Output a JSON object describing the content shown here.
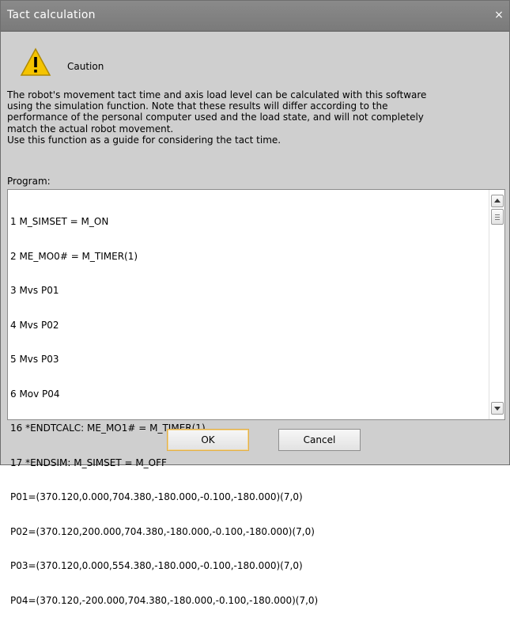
{
  "window": {
    "title": "Tact calculation",
    "close_label": "×"
  },
  "caution": {
    "icon": "warning-icon",
    "label": "Caution"
  },
  "message": {
    "lines": [
      "The robot's movement tact time and axis load level can be calculated with this software",
      "using the simulation function. Note that these results will differ according to the",
      "performance of the personal computer used and the load state, and will not completely",
      "match the actual robot movement.",
      "Use this function as a guide for considering the tact time."
    ]
  },
  "program": {
    "label": "Program:",
    "lines": [
      "1 M_SIMSET = M_ON",
      "2 ME_MO0# = M_TIMER(1)",
      "3 Mvs P01",
      "4 Mvs P02",
      "5 Mvs P03",
      "6 Mov P04",
      "16 *ENDTCALC: ME_MO1# = M_TIMER(1)",
      "17 *ENDSIM: M_SIMSET = M_OFF",
      "P01=(370.120,0.000,704.380,-180.000,-0.100,-180.000)(7,0)",
      "P02=(370.120,200.000,704.380,-180.000,-0.100,-180.000)(7,0)",
      "P03=(370.120,0.000,554.380,-180.000,-0.100,-180.000)(7,0)",
      "P04=(370.120,-200.000,704.380,-180.000,-0.100,-180.000)(7,0)"
    ]
  },
  "buttons": {
    "ok": "OK",
    "cancel": "Cancel"
  },
  "colors": {
    "titlebar": "#808080",
    "dialog_bg": "#cfcfcf",
    "ok_focus_border": "#e2b04a",
    "warning_yellow": "#f5c400"
  }
}
